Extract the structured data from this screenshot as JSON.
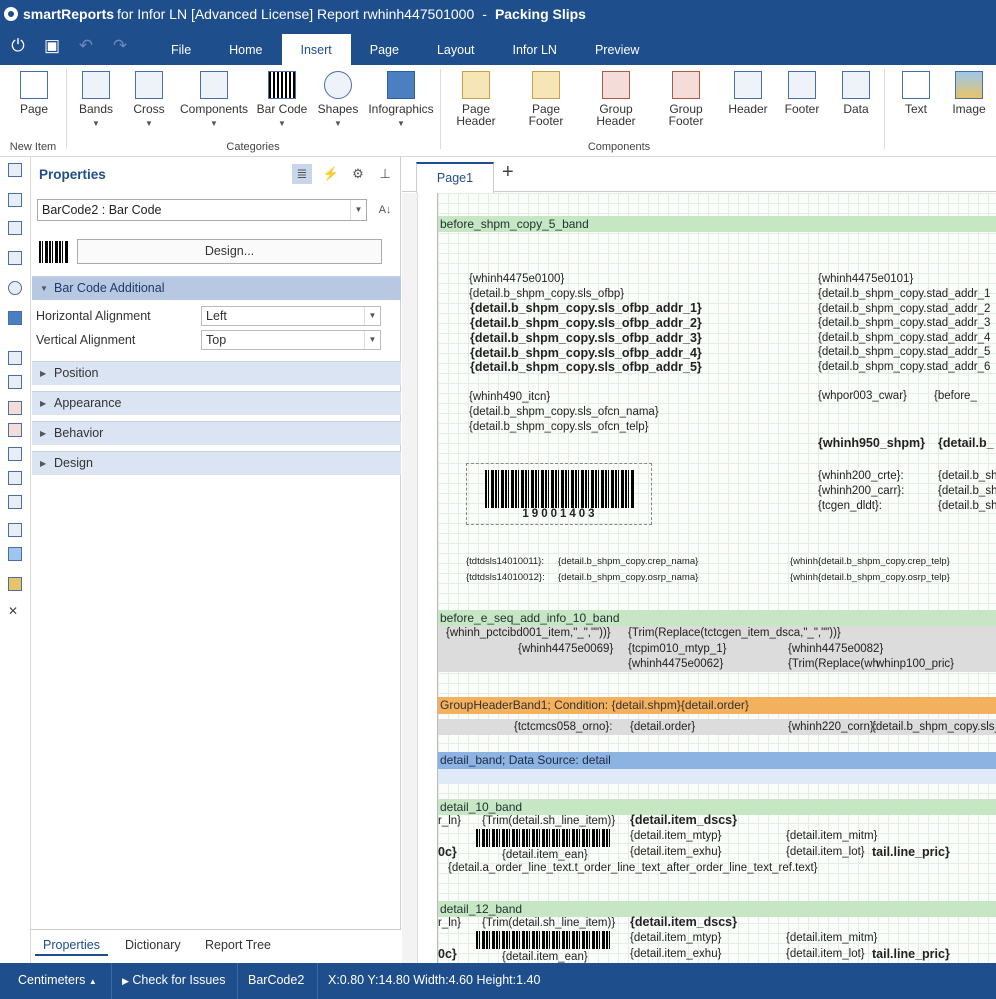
{
  "title": {
    "brand": "smartReports",
    "rest": "for Infor LN [Advanced License]  Report rwhinh447501000",
    "dash": "-",
    "doc": "Packing Slips"
  },
  "menu": {
    "tabs": [
      "File",
      "Home",
      "Insert",
      "Page",
      "Layout",
      "Infor LN",
      "Preview"
    ],
    "active": "Insert"
  },
  "ribbon": {
    "new_item": {
      "page": "Page",
      "group": "New Item"
    },
    "categories": {
      "bands": "Bands",
      "cross": "Cross",
      "components": "Components",
      "barcode": "Bar Code",
      "shapes": "Shapes",
      "infographics": "Infographics",
      "group": "Categories"
    },
    "components": {
      "page_header": [
        "Page",
        "Header"
      ],
      "page_footer": [
        "Page",
        "Footer"
      ],
      "group_header": [
        "Group",
        "Header"
      ],
      "group_footer": [
        "Group",
        "Footer"
      ],
      "header": "Header",
      "footer": "Footer",
      "data": "Data",
      "text": "Text",
      "image": "Image",
      "group": "Components"
    }
  },
  "properties": {
    "title": "Properties",
    "object": "BarCode2 : Bar Code",
    "design_button": "Design...",
    "sections": [
      "Bar Code Additional",
      "Position",
      "Appearance",
      "Behavior",
      "Design"
    ],
    "h_align_label": "Horizontal Alignment",
    "h_align_value": "Left",
    "v_align_label": "Vertical Alignment",
    "v_align_value": "Top",
    "tabs": [
      "Properties",
      "Dictionary",
      "Report Tree"
    ]
  },
  "canvas": {
    "page_tab": "Page1",
    "add": "+",
    "bands": {
      "b1": "before_shpm_copy_5_band",
      "b2": "before_e_seq_add_info_10_band",
      "b3": "GroupHeaderBand1; Condition: {detail.shpm}{detail.order}",
      "b4": "detail_band; Data Source: detail",
      "b5": "detail_10_band",
      "b6": "detail_12_band"
    },
    "left_addr": [
      "{whinh4475e0100}",
      "{detail.b_shpm_copy.sls_ofbp}",
      "{detail.b_shpm_copy.sls_ofbp_addr_1}",
      "{detail.b_shpm_copy.sls_ofbp_addr_2}",
      "{detail.b_shpm_copy.sls_ofbp_addr_3}",
      "{detail.b_shpm_copy.sls_ofbp_addr_4}",
      "{detail.b_shpm_copy.sls_ofbp_addr_5}"
    ],
    "right_addr": [
      "{whinh4475e0101}",
      "{detail.b_shpm_copy.stad_addr_1",
      "{detail.b_shpm_copy.stad_addr_2",
      "{detail.b_shpm_copy.stad_addr_3",
      "{detail.b_shpm_copy.stad_addr_4",
      "{detail.b_shpm_copy.stad_addr_5",
      "{detail.b_shpm_copy.stad_addr_6"
    ],
    "itcn": [
      "{whinh490_itcn}",
      "{detail.b_shpm_copy.sls_ofcn_nama}",
      "{detail.b_shpm_copy.sls_ofcn_telp}"
    ],
    "cwar": "{whpor003_cwar}",
    "before": "{before_",
    "shpm_bold": "{whinh950_shpm}",
    "detail_b": "{detail.b_",
    "crte": [
      "{whinh200_crte}:",
      "{whinh200_carr}:",
      "{tcgen_dldt}:"
    ],
    "detail_bsh": "{detail.b_sh",
    "barcode_text": "19001403",
    "small1": [
      "{tdtdsls14010011}:",
      "{detail.b_shpm_copy.crep_nama}",
      "{whinh",
      "{detail.b_shpm_copy.crep_telp}"
    ],
    "small2": [
      "{tdtdsls14010012}:",
      "{detail.b_shpm_copy.osrp_nama}",
      "{whinh",
      "{detail.b_shpm_copy.osrp_telp}"
    ],
    "info": [
      "{whinh_pctcibd001_item,\"_\",\"\"))}",
      "{Trim(Replace(tctcgen_item_dsca,\"_\",\"\"))}",
      "{whinh4475e0069}",
      "{tcpim010_mtyp_1}",
      "{whinh4475e0082}",
      "{whinh4475e0062}",
      "{Trim(Replace(wh",
      "whinp100_pric}"
    ],
    "gh": [
      "{tctcmcs058_orno}:",
      "{detail.order}",
      "{whinh220_corn}:",
      "{detail.b_shpm_copy.sls_c"
    ],
    "d10": [
      "r_ln}",
      "{Trim(detail.sh_line_item)}",
      "{detail.item_dscs}",
      "{detail.item_mtyp}",
      "{detail.item_mitm}",
      "{detail.item_exhu}",
      "{detail.item_lot}",
      "tail.line_pric}",
      "{detail.item_ean}",
      "0c}",
      "{detail.a_order_line_text.t_order_line_text_after_order_line_text_ref.text}"
    ]
  },
  "status": {
    "units": "Centimeters",
    "check": "Check for Issues",
    "object": "BarCode2",
    "geometry": "X:0.80 Y:14.80 Width:4.60 Height:1.40"
  }
}
